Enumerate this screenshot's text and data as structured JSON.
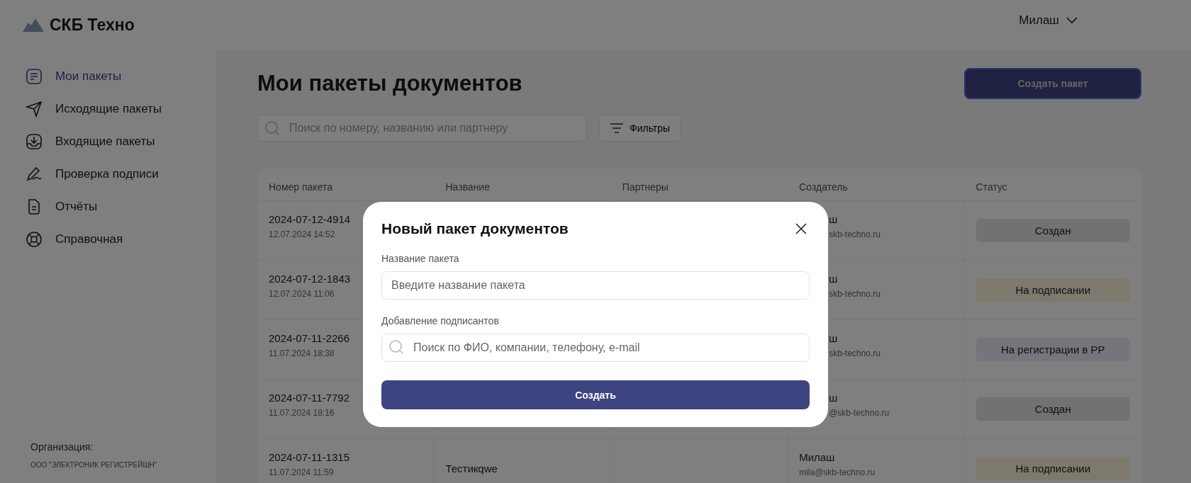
{
  "header": {
    "logo_text": "СКБ Техно",
    "user_name": "Милаш"
  },
  "sidebar": {
    "items": [
      {
        "label": "Мои пакеты",
        "selected": true
      },
      {
        "label": "Исходящие пакеты",
        "selected": false
      },
      {
        "label": "Входящие пакеты",
        "selected": false
      },
      {
        "label": "Проверка подписи",
        "selected": false
      },
      {
        "label": "Отчёты",
        "selected": false
      },
      {
        "label": "Справочная",
        "selected": false
      }
    ],
    "organization_label": "Организация:",
    "organization_name": "ООО \"ЭЛЕКТРОНИК РЕГИСТРЕЙШН\""
  },
  "page": {
    "title": "Мои пакеты документов",
    "create_button": "Создать пакет",
    "search_placeholder": "Поиск по номеру, названию или партнеру",
    "filters_button": "Фильтры"
  },
  "table": {
    "columns": [
      "Номер пакета",
      "Название",
      "Партнеры",
      "Создатель",
      "Статус"
    ],
    "rows": [
      {
        "number": "2024-07-12-4914",
        "date": "12.07.2024 14:52",
        "covered": true,
        "creator_name": "ш",
        "creator_email": "skb-techno.ru",
        "status": "Создан",
        "kind": "created"
      },
      {
        "number": "2024-07-12-1843",
        "date": "12.07.2024 11:06",
        "covered": true,
        "creator_name": "ш",
        "creator_email": "skb-techno.ru",
        "status": "На подписании",
        "kind": "signing"
      },
      {
        "number": "2024-07-11-2266",
        "date": "11.07.2024 18:38",
        "covered": true,
        "creator_name": "ш",
        "creator_email": "skb-techno.ru",
        "status": "На регистрации в РР",
        "kind": "registration"
      },
      {
        "number": "2024-07-11-7792",
        "date": "11.07.2024 18:16",
        "covered": true,
        "creator_name": "ш",
        "creator_email": "@skb-techno.ru",
        "status": "Создан",
        "kind": "created"
      },
      {
        "number": "2024-07-11-1315",
        "date": "11.07.2024 11:59",
        "covered": false,
        "name": "Тестикqwe",
        "creator_name": "Милаш",
        "creator_email": "mila@skb-techno.ru",
        "status": "На подписании",
        "kind": "signing"
      }
    ]
  },
  "modal": {
    "title": "Новый пакет документов",
    "name_label": "Название пакета",
    "name_placeholder": "Введите название пакета",
    "signers_label": "Добавление подписантов",
    "signers_placeholder": "Поиск по ФИО, компании, телефону, e-mail",
    "submit_button": "Создать"
  }
}
